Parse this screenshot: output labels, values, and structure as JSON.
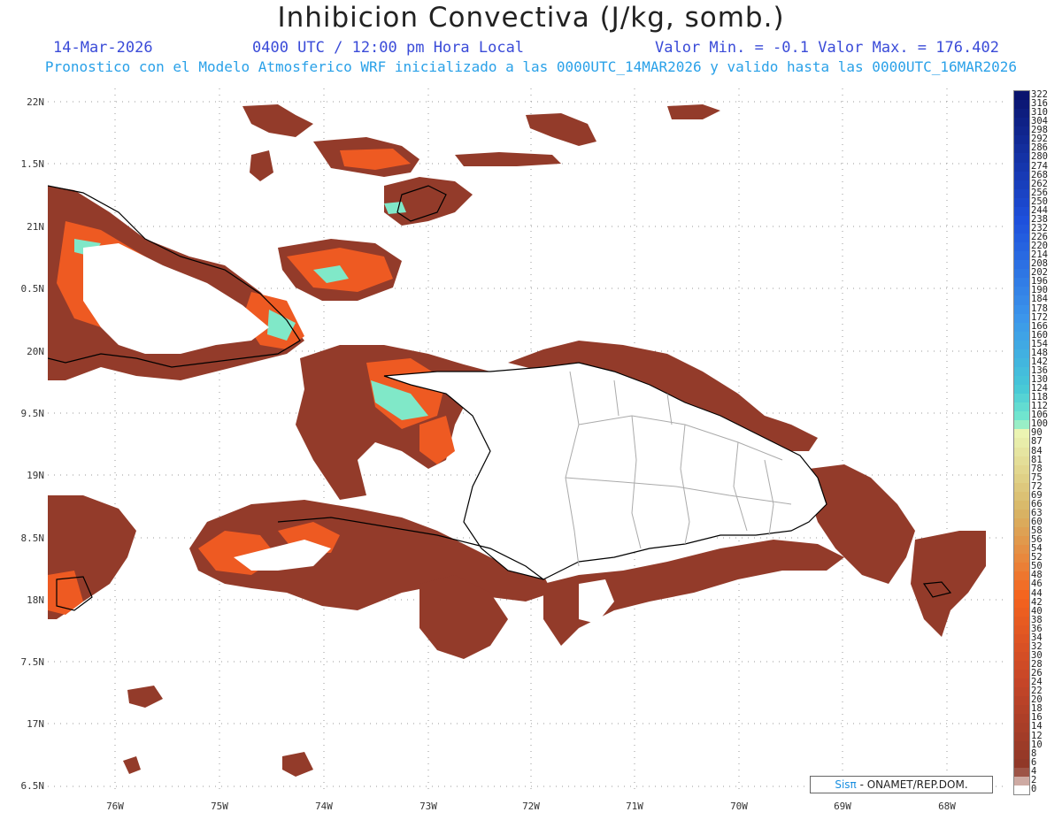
{
  "header": {
    "title": "Inhibicion Convectiva (J/kg, somb.)",
    "date": "14-Mar-2026",
    "time": "0400 UTC / 12:00 pm Hora Local",
    "range": "Valor Min. = -0.1   Valor Max. = 176.402",
    "model": "Pronostico con el Modelo Atmosferico WRF inicializado a las 0000UTC_14MAR2026 y valido hasta las  0000UTC_16MAR2026"
  },
  "axes": {
    "lat_labels": [
      "22N",
      "1.5N",
      "21N",
      "0.5N",
      "20N",
      "9.5N",
      "19N",
      "8.5N",
      "18N",
      "7.5N",
      "17N",
      "6.5N"
    ],
    "lon_labels": [
      "76W",
      "75W",
      "74W",
      "73W",
      "72W",
      "71W",
      "70W",
      "69W",
      "68W"
    ]
  },
  "colorbar": {
    "labels": [
      "322",
      "316",
      "310",
      "304",
      "298",
      "292",
      "286",
      "280",
      "274",
      "268",
      "262",
      "256",
      "250",
      "244",
      "238",
      "232",
      "226",
      "220",
      "214",
      "208",
      "202",
      "196",
      "190",
      "184",
      "178",
      "172",
      "166",
      "160",
      "154",
      "148",
      "142",
      "136",
      "130",
      "124",
      "118",
      "112",
      "106",
      "100",
      "90",
      "87",
      "84",
      "81",
      "78",
      "75",
      "72",
      "69",
      "66",
      "63",
      "60",
      "58",
      "56",
      "54",
      "52",
      "50",
      "48",
      "46",
      "44",
      "42",
      "40",
      "38",
      "36",
      "34",
      "32",
      "30",
      "28",
      "26",
      "24",
      "22",
      "20",
      "18",
      "16",
      "14",
      "12",
      "10",
      "8",
      "6",
      "4",
      "2",
      "0"
    ]
  },
  "credit": {
    "logo": "Sisπ",
    "text": " - ONAMET/REP.DOM."
  },
  "colors": {
    "cin_low": "#933b2a",
    "cin_mid": "#ee5a22",
    "cin_high": "#80e8c8",
    "land_border": "#000000",
    "province_border": "#aaaaaa"
  }
}
